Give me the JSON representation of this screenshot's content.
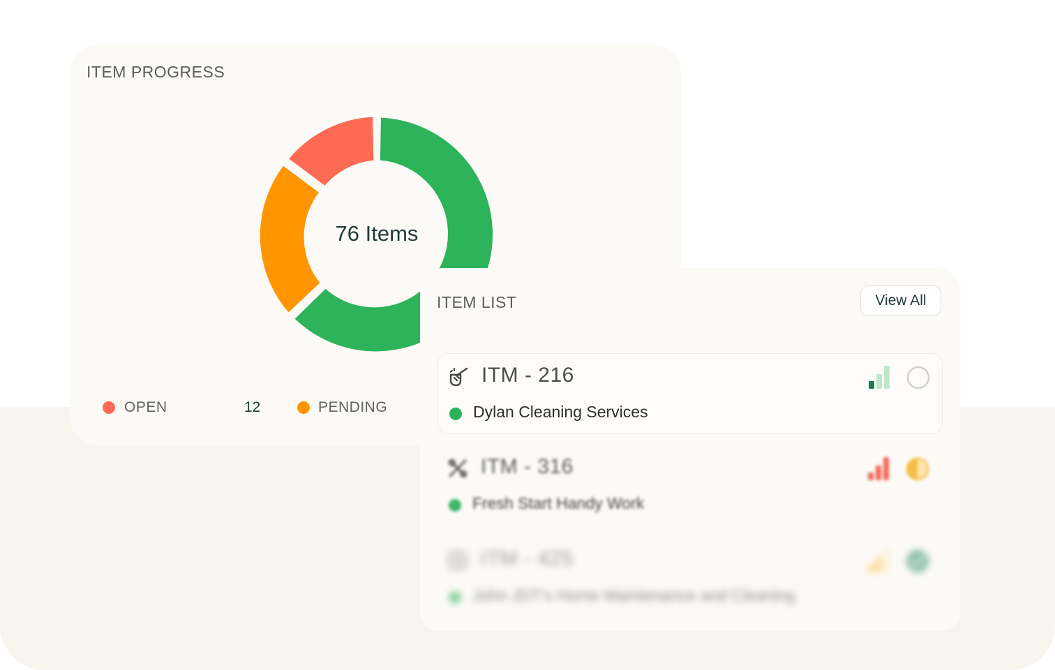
{
  "progress": {
    "title": "ITEM PROGRESS",
    "center_text": "76 Items",
    "legend": [
      {
        "label": "OPEN",
        "value": "12",
        "color": "#ff6a55"
      },
      {
        "label": "PENDING",
        "value": "",
        "color": "#ff9500"
      }
    ],
    "segment_colors": {
      "done": "#2db35a",
      "open": "#ff6a55",
      "pending": "#ff9500"
    }
  },
  "item_list": {
    "title": "ITEM LIST",
    "view_all_label": "View All",
    "items": [
      {
        "code": "ITM - 216",
        "vendor": "Dylan Cleaning Services",
        "icon": "broom-icon",
        "priority": "low",
        "status": "not-started"
      },
      {
        "code": "ITM - 316",
        "vendor": "Fresh Start Handy Work",
        "icon": "tools-icon",
        "priority": "high",
        "status": "in-progress"
      },
      {
        "code": "ITM - 425",
        "vendor": "John JDT's Home Maintenance and Cleaning",
        "icon": "grid-icon",
        "priority": "medium",
        "status": "completed"
      }
    ]
  }
}
